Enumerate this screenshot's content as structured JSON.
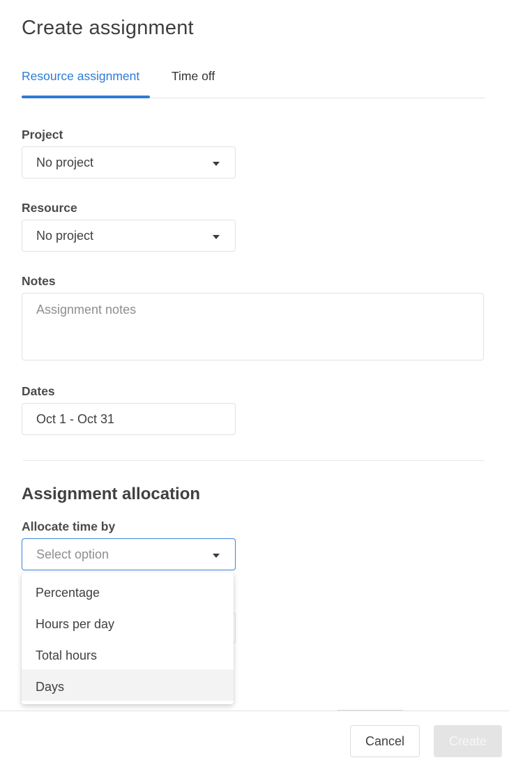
{
  "dialog": {
    "title": "Create assignment"
  },
  "tabs": [
    {
      "label": "Resource assignment",
      "active": true
    },
    {
      "label": "Time off",
      "active": false
    }
  ],
  "form": {
    "project": {
      "label": "Project",
      "value": "No project"
    },
    "resource": {
      "label": "Resource",
      "value": "No project"
    },
    "notes": {
      "label": "Notes",
      "placeholder": "Assignment notes",
      "value": ""
    },
    "dates": {
      "label": "Dates",
      "value": "Oct 1 - Oct 31"
    }
  },
  "allocation": {
    "section_title": "Assignment allocation",
    "allocate_by": {
      "label": "Allocate time by",
      "placeholder": "Select option",
      "options": [
        {
          "label": "Percentage"
        },
        {
          "label": "Hours per day"
        },
        {
          "label": "Total hours"
        },
        {
          "label": "Days",
          "hovered": true
        }
      ]
    }
  },
  "footer": {
    "cancel_label": "Cancel",
    "create_label": "Create",
    "create_disabled": true
  },
  "colors": {
    "accent": "#2e7bd6",
    "focus_border": "#3b82d8",
    "disabled_button": "#e4e4e4",
    "hover_row": "#f3f3f3"
  },
  "icons": {
    "dropdown": "caret-down-icon"
  }
}
